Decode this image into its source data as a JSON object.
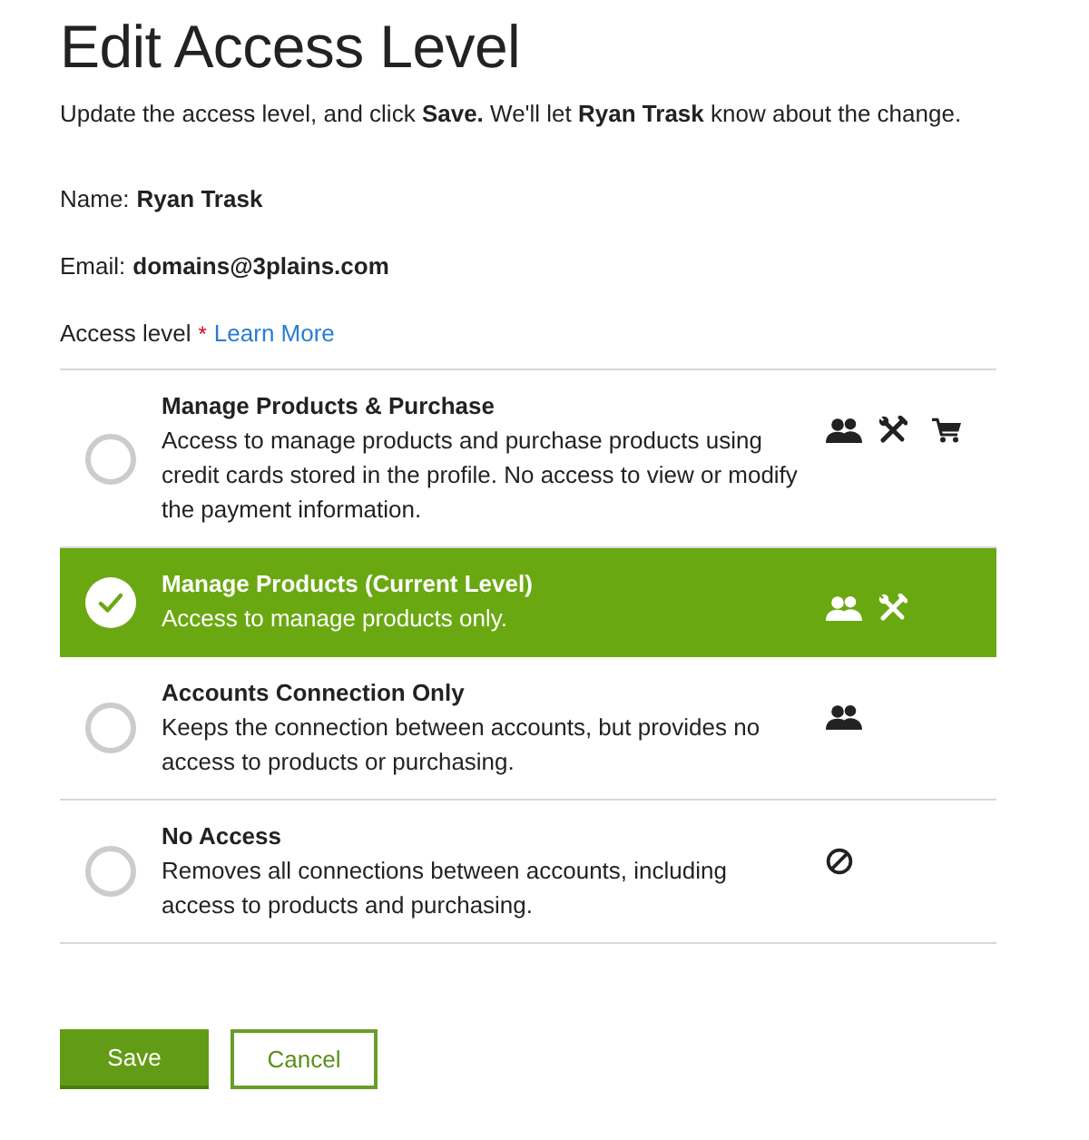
{
  "title": "Edit Access Level",
  "intro": "Update the access level, and click **Save.** We'll let **Ryan Trask** know about the change.",
  "fields": [
    {
      "label": "Name:",
      "value": "Ryan Trask"
    },
    {
      "label": "Email:",
      "value": "domains@3plains.com"
    }
  ],
  "access_level": {
    "label": "Access level",
    "required_mark": "*",
    "link": "Learn More"
  },
  "options": [
    {
      "title": "Manage Products & Purchase",
      "description": "Access to manage products and purchase products using credit cards stored in the profile. No access to view or modify the payment information.",
      "selected": false,
      "permissions": [
        {
          "kind": "accounts"
        },
        {
          "kind": "products"
        },
        {
          "kind": "purchase"
        }
      ]
    },
    {
      "title": "Manage Products (Current Level)",
      "description": "Access to manage products only.",
      "selected": true,
      "permissions": [
        {
          "kind": "accounts"
        },
        {
          "kind": "products"
        }
      ]
    },
    {
      "title": "Accounts Connection Only",
      "description": "Keeps the connection between accounts, but provides no access to products or purchasing.",
      "selected": false,
      "permissions": [
        {
          "kind": "accounts"
        }
      ]
    },
    {
      "title": "No Access",
      "description": "Removes all connections between accounts, including access to products and purchasing.",
      "selected": false,
      "permissions": [
        {
          "kind": "none"
        }
      ]
    }
  ],
  "buttons": [
    {
      "label": "Save",
      "kind": "primary"
    },
    {
      "label": "Cancel",
      "kind": "secondary"
    }
  ]
}
